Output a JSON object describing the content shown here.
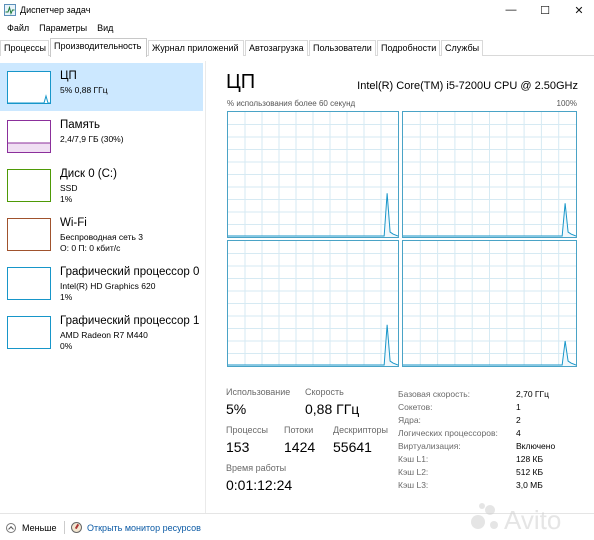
{
  "window": {
    "title": "Диспетчер задач",
    "controls": [
      "—",
      "☐",
      "✕"
    ]
  },
  "menu": [
    "Файл",
    "Параметры",
    "Вид"
  ],
  "tabs": [
    "Процессы",
    "Производительность",
    "Журнал приложений",
    "Автозагрузка",
    "Пользователи",
    "Подробности",
    "Службы"
  ],
  "active_tab": "Производительность",
  "sidebar": [
    {
      "title": "ЦП",
      "line1": "5% 0,88 ГГц",
      "line2": "",
      "color": "#1796c9",
      "selected": true
    },
    {
      "title": "Память",
      "line1": "2,4/7,9 ГБ (30%)",
      "line2": "",
      "color": "#8b2f9b",
      "selected": false
    },
    {
      "title": "Диск 0 (C:)",
      "line1": "SSD",
      "line2": "1%",
      "color": "#4e9a06",
      "selected": false
    },
    {
      "title": "Wi-Fi",
      "line1": "Беспроводная сеть 3",
      "line2": "О: 0 П: 0 кбит/с",
      "color": "#a0522d",
      "selected": false
    },
    {
      "title": "Графический процессор 0",
      "line1": "Intel(R) HD Graphics 620",
      "line2": "1%",
      "color": "#1796c9",
      "selected": false
    },
    {
      "title": "Графический процессор 1",
      "line1": "AMD Radeon R7 M440",
      "line2": "0%",
      "color": "#1796c9",
      "selected": false
    }
  ],
  "main": {
    "title": "ЦП",
    "cpu_model": "Intel(R) Core(TM) i5-7200U CPU @ 2.50GHz",
    "graph_caption": "% использования более 60 секунд",
    "graph_max": "100%",
    "graph_color": "#1796c9"
  },
  "stats": {
    "usage_label": "Использование",
    "usage_value": "5%",
    "speed_label": "Скорость",
    "speed_value": "0,88 ГГц",
    "processes_label": "Процессы",
    "processes_value": "153",
    "threads_label": "Потоки",
    "threads_value": "1424",
    "handles_label": "Дескрипторы",
    "handles_value": "55641",
    "uptime_label": "Время работы",
    "uptime_value": "0:01:12:24"
  },
  "specs": [
    {
      "label": "Базовая скорость:",
      "value": "2,70 ГГц"
    },
    {
      "label": "Сокетов:",
      "value": "1"
    },
    {
      "label": "Ядра:",
      "value": "2"
    },
    {
      "label": "Логических процессоров:",
      "value": "4"
    },
    {
      "label": "Виртуализация:",
      "value": "Включено"
    },
    {
      "label": "Кэш L1:",
      "value": "128 КБ"
    },
    {
      "label": "Кэш L2:",
      "value": "512 КБ"
    },
    {
      "label": "Кэш L3:",
      "value": "3,0 МБ"
    }
  ],
  "footer": {
    "less_label": "Меньше",
    "monitor_link": "Открыть монитор ресурсов"
  },
  "watermark": "Avito"
}
